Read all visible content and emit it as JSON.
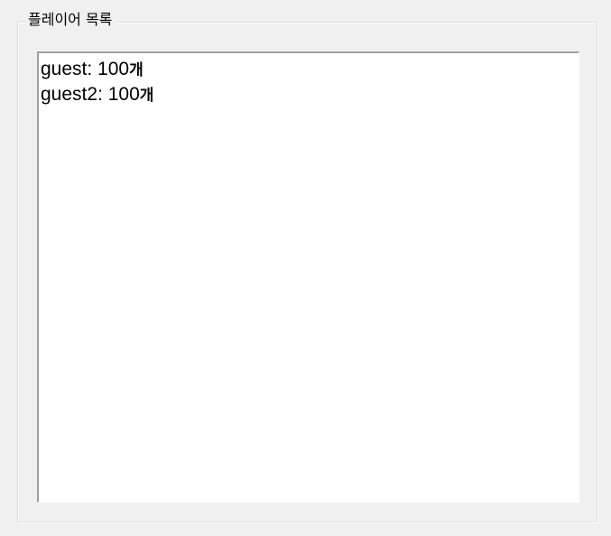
{
  "groupbox": {
    "title": "플레이어 목록"
  },
  "player_list": {
    "items": [
      {
        "name": "guest",
        "separator": ": ",
        "count": "100",
        "unit": "개"
      },
      {
        "name": "guest2",
        "separator": ": ",
        "count": "100",
        "unit": "개"
      }
    ]
  }
}
